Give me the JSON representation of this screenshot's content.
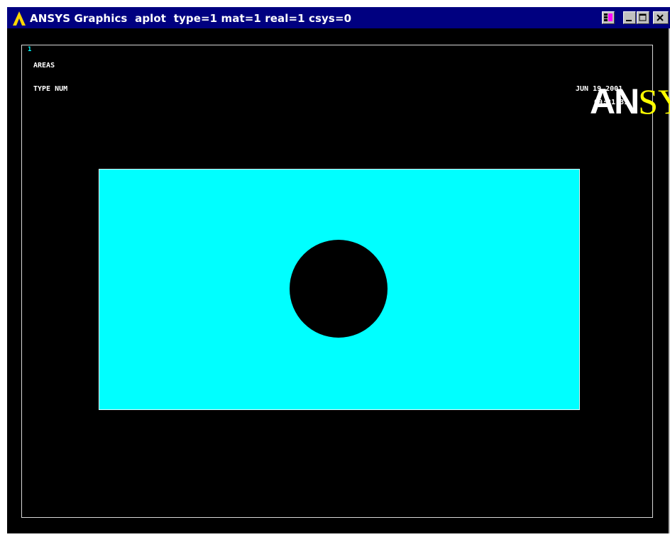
{
  "window": {
    "title": "ANSYS Graphics  aplot  type=1 mat=1 real=1 csys=0",
    "controls": [
      "restore-menu",
      "minimize",
      "maximize",
      "close"
    ]
  },
  "graphics": {
    "window_number": "1",
    "entity_label": "AREAS",
    "numbering_label": "TYPE NUM",
    "date": "JUN 19 2001",
    "time": "09:21:31",
    "logo": {
      "part1": "AN",
      "part2": "SYS"
    }
  },
  "colors": {
    "title_bar": "#000080",
    "background": "#000000",
    "area_fill": "#00ffff",
    "logo_accent": "#ffff00"
  }
}
